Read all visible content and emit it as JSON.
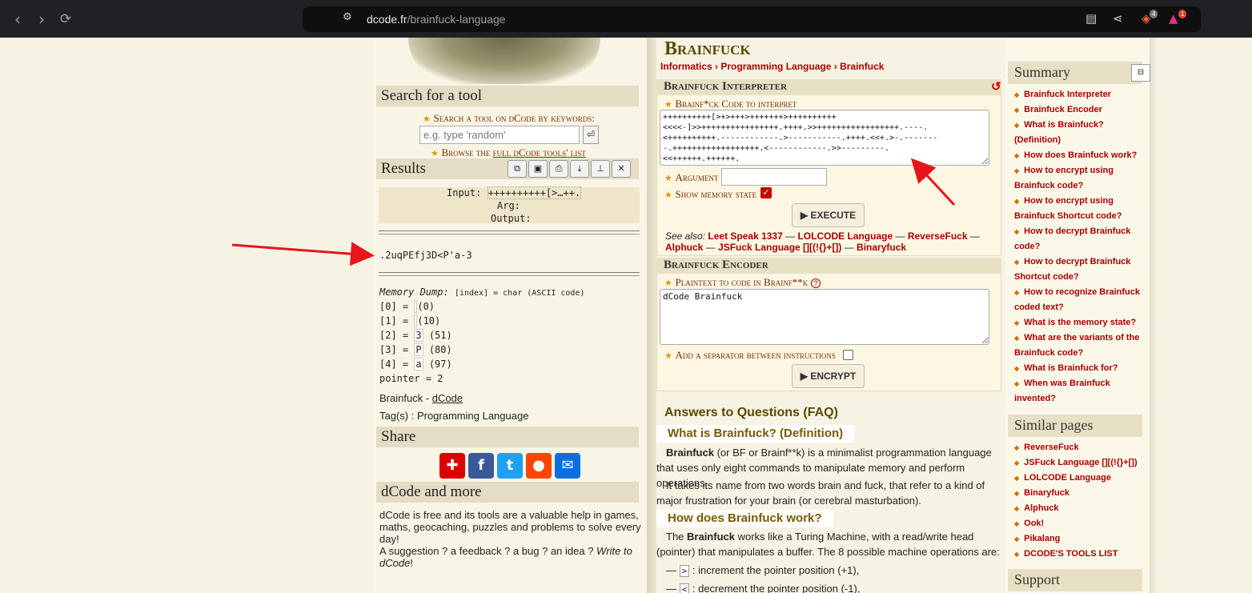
{
  "browser": {
    "url_host": "dcode.fr",
    "url_path": "/brainfuck-language",
    "shields_count": "4",
    "rewards_count": "1"
  },
  "sidebar_left": {
    "search_title": "Search for a tool",
    "search_label": "Search a tool on dCode by keywords:",
    "search_placeholder": "e.g. type 'random'",
    "browse_prefix": "Browse the ",
    "browse_link": "full dCode tools' list",
    "results_title": "Results",
    "input_label": "Input:",
    "input_value": "++++++++++[>…++.",
    "arg_label": "Arg:",
    "output_label": "Output:",
    "output_value": ".2uqPEfj3D<P'a-3",
    "memory_title": "Memory Dump:",
    "memory_legend": "[index] = char (ASCII code)",
    "memory": [
      {
        "idx": "[0] = ",
        "char": " ",
        "code": "(0)"
      },
      {
        "idx": "[1] = ",
        "char": " ",
        "code": "(10)"
      },
      {
        "idx": "[2] = ",
        "char": "3",
        "code": "(51)"
      },
      {
        "idx": "[3] = ",
        "char": "P",
        "code": "(80)"
      },
      {
        "idx": "[4] = ",
        "char": "a",
        "code": "(97)"
      }
    ],
    "pointer": "pointer = 2",
    "credit_prefix": "Brainfuck - ",
    "credit_link": "dCode",
    "tags": "Tag(s) : Programming Language",
    "share_title": "Share",
    "more_title": "dCode and more",
    "more_text": "dCode is free and its tools are a valuable help in games, maths, geocaching, puzzles and problems to solve every day!",
    "more_text2": "A suggestion ? a feedback ? a bug ? an idea ? ",
    "more_link": "Write to dCode",
    "more_end": "!"
  },
  "main": {
    "page_title": "Brainfuck",
    "breadcrumb": [
      "Informatics",
      "Programming Language",
      "Brainfuck"
    ],
    "interpreter_title": "Brainfuck Interpreter",
    "code_label": "Brainf*ck Code to interpret",
    "code_value": "++++++++++[>+>+++>+++++++>++++++++++\n<<<<-]>>++++++++++++++++.++++.>>+++++++++++++++++.----.\n<++++++++++.------------.>-----------.++++.<<+.>-.-------\n-.++++++++++++++++++.<------------.>>---------.\n<<++++++.++++++.",
    "argument_label": "Argument",
    "show_memory_label": "Show memory state",
    "execute_label": "▶ EXECUTE",
    "see_also_label": "See also:",
    "see_also": [
      "Leet Speak 1337",
      "LOLCODE Language",
      "ReverseFuck",
      "Alphuck",
      "JSFuck Language [][(!{}+[])",
      "Binaryfuck"
    ],
    "encoder_title": "Brainfuck Encoder",
    "plaintext_label": "Plaintext to code in Brainf**k",
    "plaintext_value": "dCode Brainfuck",
    "separator_label": "Add a separator between instructions",
    "encrypt_label": "▶ ENCRYPT",
    "faq_title": "Answers to Questions (FAQ)",
    "q1": "What is Brainfuck? (Definition)",
    "a1_bold": "Brainfuck",
    "a1": " (or BF or Brainf**k) is a minimalist programmation language that uses only eight commands to manipulate memory and perform operations.",
    "a1b": "It takes its name from two words brain and fuck, that refer to a kind of major frustration for your brain (or cerebral masturbation).",
    "q2": "How does Brainfuck work?",
    "a2_pre": "The ",
    "a2_bold": "Brainfuck",
    "a2": " works like a Turing Machine, with a read/write head (pointer) that manipulates a buffer. The 8 possible machine operations are:",
    "op1_sym": ">",
    "op1": " : increment the pointer position (+1),",
    "op2_sym": "<",
    "op2": " : decrement the pointer position (-1),"
  },
  "sidebar_right": {
    "summary_title": "Summary",
    "summary": [
      "Brainfuck Interpreter",
      "Brainfuck Encoder",
      "What is Brainfuck? (Definition)",
      "How does Brainfuck work?",
      "How to encrypt using Brainfuck code?",
      "How to encrypt using Brainfuck Shortcut code?",
      "How to decrypt Brainfuck code?",
      "How to decrypt Brainfuck Shortcut code?",
      "How to recognize Brainfuck coded text?",
      "What is the memory state?",
      "What are the variants of the Brainfuck code?",
      "What is Brainfuck for?",
      "When was Brainfuck invented?"
    ],
    "similar_title": "Similar pages",
    "similar": [
      "ReverseFuck",
      "JSFuck Language [][(!{}+[])",
      "LOLCODE Language",
      "Binaryfuck",
      "Alphuck",
      "Ook!",
      "Pikalang",
      "DCODE'S TOOLS LIST"
    ],
    "support_title": "Support"
  },
  "colors": {
    "accent_red": "#aa0000",
    "header_bg": "#e8e0c4",
    "page_bg": "#f6f3e4"
  }
}
